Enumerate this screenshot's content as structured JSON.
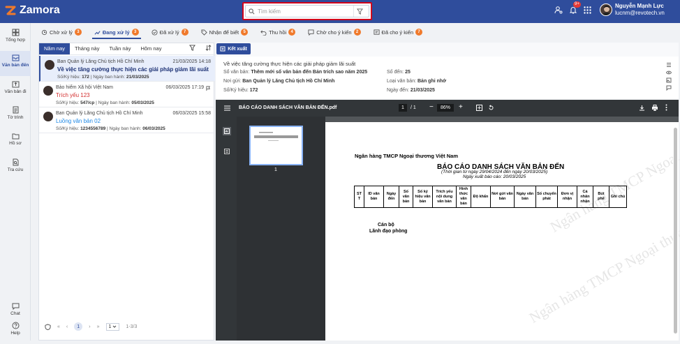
{
  "app": {
    "name": "Zamora"
  },
  "search": {
    "placeholder": "Tìm kiếm"
  },
  "user": {
    "name": "Nguyễn Mạnh Lực",
    "email": "lucnm@revotech.vn",
    "notif_badge": "9+"
  },
  "sidebar": {
    "items": [
      {
        "label": "Tổng hợp"
      },
      {
        "label": "Văn bản đến"
      },
      {
        "label": "Văn bản đi"
      },
      {
        "label": "Tờ trình"
      },
      {
        "label": "Hồ sơ"
      },
      {
        "label": "Tra cứu"
      },
      {
        "label": "Chat"
      },
      {
        "label": "Help"
      }
    ]
  },
  "tabs": [
    {
      "label": "Chờ xử lý",
      "count": "3"
    },
    {
      "label": "Đang xử lý",
      "count": "3"
    },
    {
      "label": "Đã xử lý",
      "count": "7"
    },
    {
      "label": "Nhận để biết",
      "count": "5"
    },
    {
      "label": "Thu hồi",
      "count": "4"
    },
    {
      "label": "Chờ cho ý kiến",
      "count": "2"
    },
    {
      "label": "Đã cho ý kiến",
      "count": "7"
    }
  ],
  "filter_tabs": [
    "Năm nay",
    "Tháng này",
    "Tuần này",
    "Hôm nay"
  ],
  "docs": [
    {
      "sender": "Ban Quản lý Lăng Chủ tịch Hồ Chí Minh",
      "date": "21/03/2025 14:18",
      "title": "Về việc tăng cường thực hiện các giải pháp giảm lãi suất",
      "kyhieu_label": "Số/Ký hiệu:",
      "kyhieu": "172",
      "banhanh_label": "| Ngày ban hành:",
      "banhanh": "21/03/2025"
    },
    {
      "sender": "Bảo hiểm Xã hội Việt Nam",
      "date": "06/03/2025 17:19",
      "title": "Trích yếu 123",
      "kyhieu_label": "Số/Ký hiệu:",
      "kyhieu": "547/cp",
      "banhanh_label": "| Ngày ban hành:",
      "banhanh": "05/03/2025"
    },
    {
      "sender": "Ban Quản lý Lăng Chủ tịch Hồ Chí Minh",
      "date": "06/03/2025 15:58",
      "title": "Luồng văn bản 02",
      "kyhieu_label": "Số/Ký hiệu:",
      "kyhieu": "1234556789",
      "banhanh_label": "| Ngày ban hành:",
      "banhanh": "06/03/2025"
    }
  ],
  "pagination": {
    "current": "1",
    "per_page": "1",
    "range": "1-3/3"
  },
  "export_label": "Kết xuất",
  "detail": {
    "title": "Về việc tăng cường thực hiện các giải pháp giảm lãi suất",
    "so_van_ban_label": "Sổ văn bản:",
    "so_van_ban": "Thêm mới sổ văn bản đến Bản trích sao năm 2025",
    "so_den_label": "Số đến:",
    "so_den": "25",
    "noi_gui_label": "Nơi gửi:",
    "noi_gui": "Ban Quản lý Lăng Chủ tịch Hồ Chí Minh",
    "loai_label": "Loại văn bản:",
    "loai": "Bản ghi nhớ",
    "ky_hieu_label": "Số/Ký hiệu:",
    "ky_hieu": "172",
    "ngay_den_label": "Ngày đến:",
    "ngay_den": "21/03/2025"
  },
  "pdf": {
    "filename": "BÁO CÁO DANH SÁCH VĂN BẢN ĐẾN.pdf",
    "page_current": "1",
    "page_total": "/ 1",
    "zoom": "86%",
    "thumb_label": "1",
    "bank": "Ngân hàng TMCP Ngoại thương Việt Nam",
    "report_title": "BÁO CÁO DANH SÁCH VĂN BẢN ĐẾN",
    "period": "(Thời gian từ ngày 29/04/2024 đến ngày 20/03/2025)",
    "export_date": "Ngày xuất báo cáo: 20/03/2025",
    "columns": [
      "ST T",
      "ID văn bản",
      "Ngày đến",
      "Số văn bản",
      "Số ký hiệu văn bản",
      "Trích yếu nội dung văn bản",
      "Hình thức văn bản",
      "Độ khẩn",
      "Nơi gửi văn bản",
      "Ngày văn bản",
      "Số chuyển phát",
      "Đơn vị nhận",
      "Cá nhân nhận",
      "Bút phê",
      "Ghi chú"
    ],
    "sign1": "Cán bộ",
    "sign2": "Lãnh đạo phòng",
    "watermark": "Ngân hàng TMCP Ngoại thương Việt Nam"
  },
  "colors": {
    "primary": "#2f4d9c",
    "badge": "#f07a2c",
    "highlight": "#d0021b"
  }
}
